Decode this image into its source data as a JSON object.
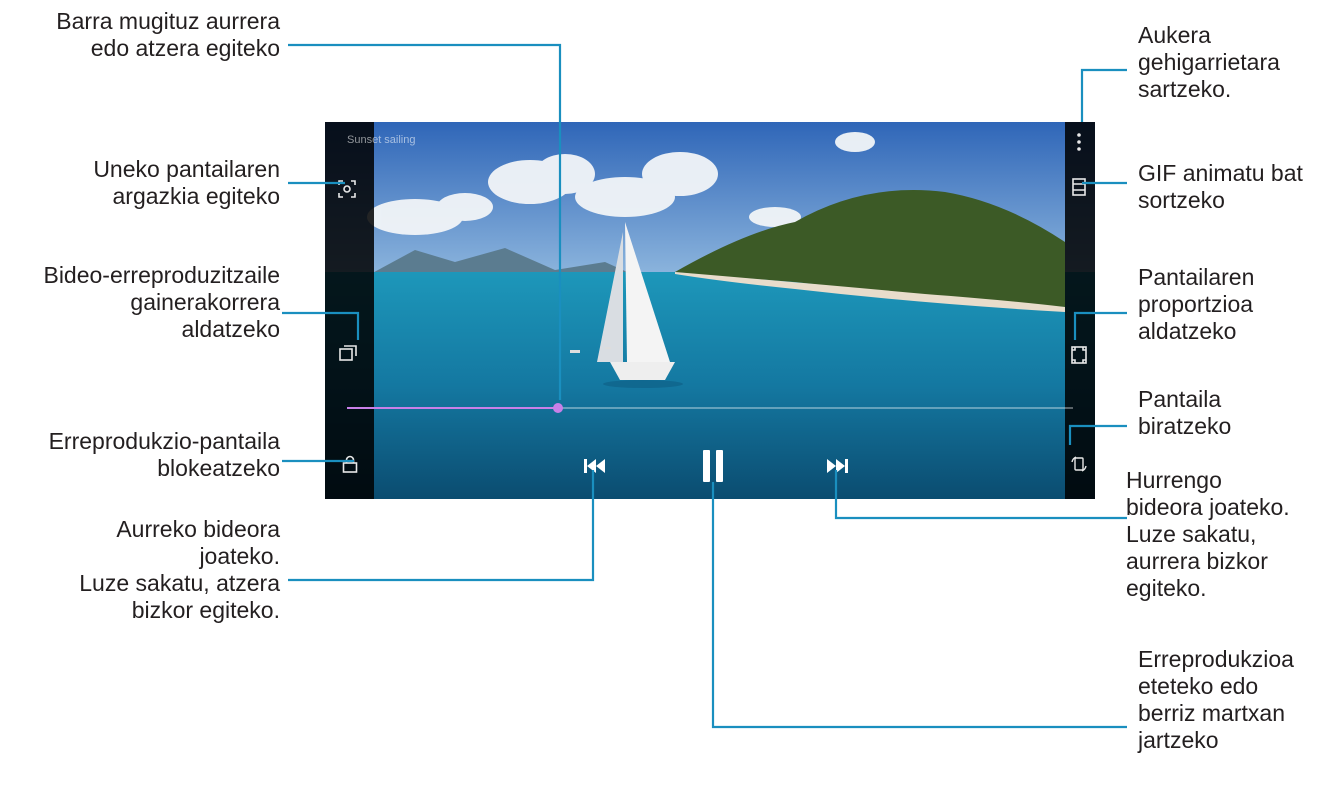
{
  "callouts": {
    "seek_bar": "Barra mugituz aurrera\nedo atzera egiteko",
    "capture": "Uneko pantailaren\nargazkia egiteko",
    "popup_player": "Bideo-erreproduzitzaile\ngainerakorrera\naldatzeko",
    "lock": "Erreprodukzio-pantaila\nblokeatzeko",
    "previous": "Aurreko bideora\njoateko.\nLuze sakatu, atzera\nbizkor egiteko.",
    "more_options": "Aukera\ngehigarrietara\nsartzeko.",
    "gif": "GIF animatu bat\nsortzeko",
    "ratio": "Pantailaren\nproportzioa\naldatzeko",
    "rotate": "Pantaila\nbiratzeko",
    "next": "Hurrengo\nbideora joateko.\nLuze sakatu,\naurrera bizkor\negiteko.",
    "play_pause": "Erreprodukzioa\neteteko edo\nberriz martxan\njartzeko"
  },
  "player": {
    "title": "Sunset sailing",
    "subtitle": "",
    "progress": 0.29,
    "accent_color": "#c880e8"
  },
  "icons": {
    "capture": "capture-icon",
    "popup": "popup-player-icon",
    "lock": "lock-icon",
    "previous": "skip-previous-icon",
    "pause": "pause-icon",
    "next": "skip-next-icon",
    "more": "more-options-icon",
    "gif": "gif-icon",
    "ratio": "screen-ratio-icon",
    "rotate": "rotate-screen-icon"
  },
  "colors": {
    "leader_line": "#1a8fbf",
    "text": "#231f20"
  }
}
